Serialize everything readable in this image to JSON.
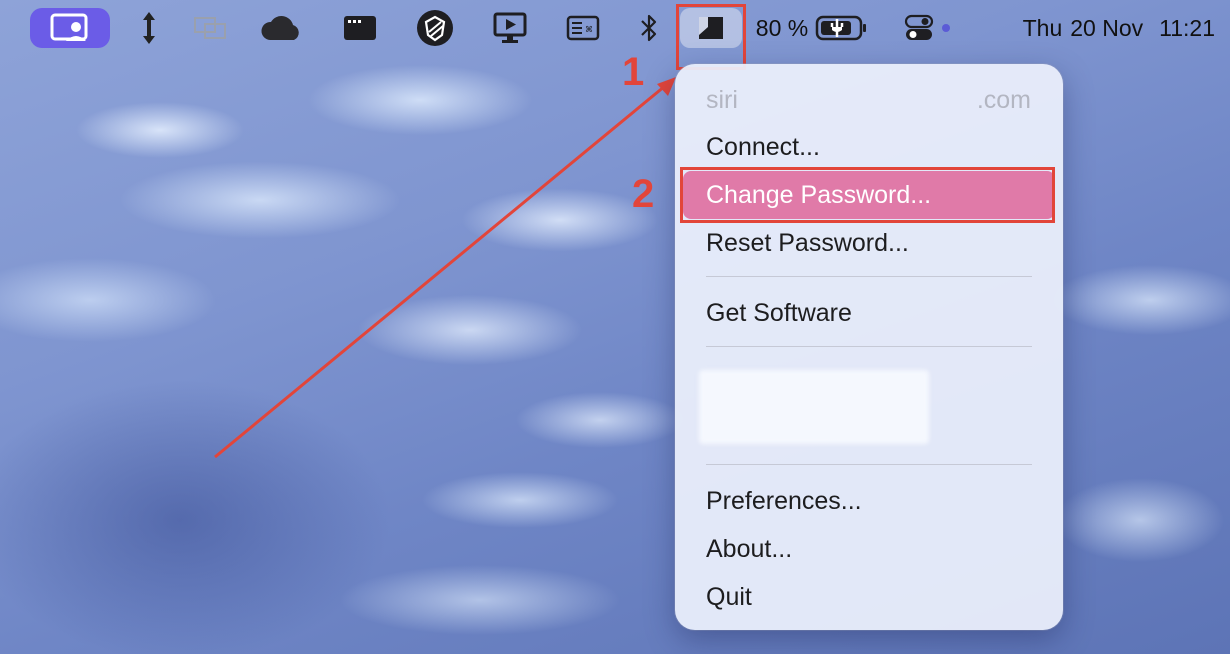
{
  "menubar": {
    "icons": [
      "screen-share-icon",
      "vertical-arrows-icon",
      "display-mirror-icon",
      "cloud-icon",
      "terminal-window-icon",
      "security-shield-icon",
      "screen-player-icon",
      "keyboard-viewer-icon",
      "bluetooth-icon",
      "app-tray-icon",
      "battery-charging-icon",
      "control-center-icon"
    ],
    "battery_percent": "80 %",
    "day": "Thu",
    "date": "20 Nov",
    "time": "11:21"
  },
  "annotations": {
    "step1": "1",
    "step2": "2"
  },
  "menu": {
    "account_prefix": "siri",
    "account_suffix": ".com",
    "items": [
      {
        "label": "Connect..."
      },
      {
        "label": "Change Password..."
      },
      {
        "label": "Reset Password..."
      },
      {
        "label": "Get Software"
      },
      {
        "label": "Preferences..."
      },
      {
        "label": "About..."
      },
      {
        "label": "Quit"
      }
    ]
  },
  "colors": {
    "accent_purple": "#6b5ce7",
    "highlight_pink": "#e07aa8",
    "annotation_red": "#e2453a"
  }
}
